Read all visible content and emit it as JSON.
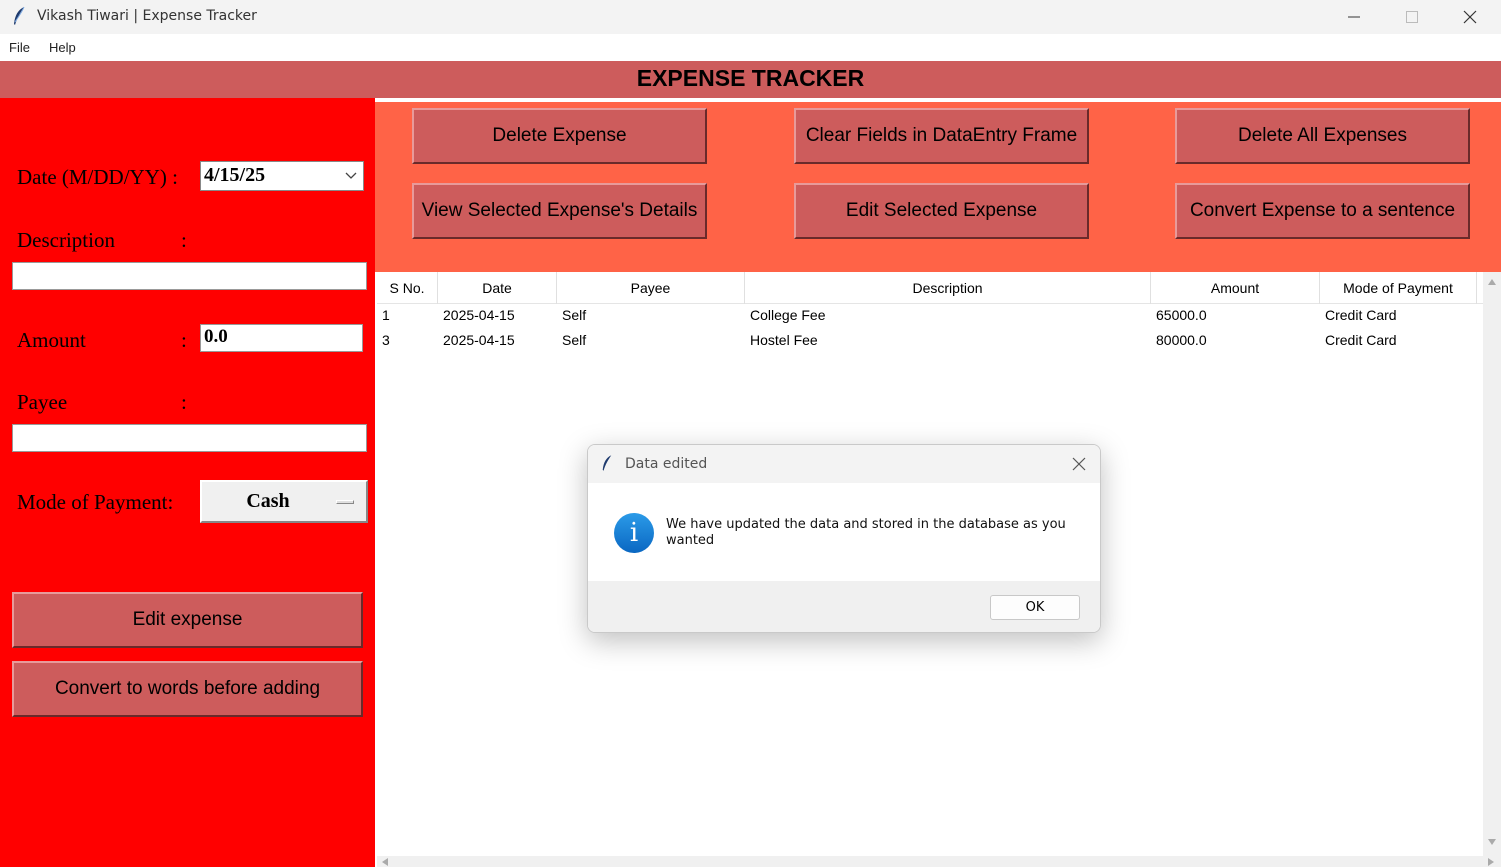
{
  "window": {
    "title": "Vikash Tiwari | Expense Tracker",
    "icon": "feather-icon"
  },
  "menubar": {
    "items": [
      {
        "label": "File"
      },
      {
        "label": "Help"
      }
    ]
  },
  "header": {
    "title": "EXPENSE TRACKER"
  },
  "form": {
    "date_label": "Date (M/DD/YY) :",
    "date_value": "4/15/25",
    "description_label": "Description",
    "description_value": "",
    "amount_label": "Amount",
    "amount_value": "0.0",
    "payee_label": "Payee",
    "payee_value": "",
    "mode_label": "Mode of Payment:",
    "mode_value": "Cash",
    "colon": ":",
    "edit_button": "Edit expense",
    "convert_button": "Convert to words before adding"
  },
  "actions": {
    "delete": "Delete Expense",
    "clear": "Clear Fields in DataEntry Frame",
    "delete_all": "Delete All Expenses",
    "view": "View Selected Expense's Details",
    "edit": "Edit Selected Expense",
    "convert": "Convert Expense to a sentence"
  },
  "table": {
    "columns": [
      "S No.",
      "Date",
      "Payee",
      "Description",
      "Amount",
      "Mode of Payment"
    ],
    "rows": [
      [
        "1",
        "2025-04-15",
        "Self",
        "College Fee",
        "65000.0",
        "Credit Card"
      ],
      [
        "3",
        "2025-04-15",
        "Self",
        "Hostel Fee",
        "80000.0",
        "Credit Card"
      ]
    ]
  },
  "dialog": {
    "title": "Data edited",
    "message": "We have updated the data and stored in the database as you wanted",
    "ok": "OK",
    "icon": "info-icon"
  },
  "colors": {
    "left_panel": "#ff0000",
    "header": "#cd5c5c",
    "button_panel": "#ff6347",
    "button": "#cd5c5c"
  }
}
